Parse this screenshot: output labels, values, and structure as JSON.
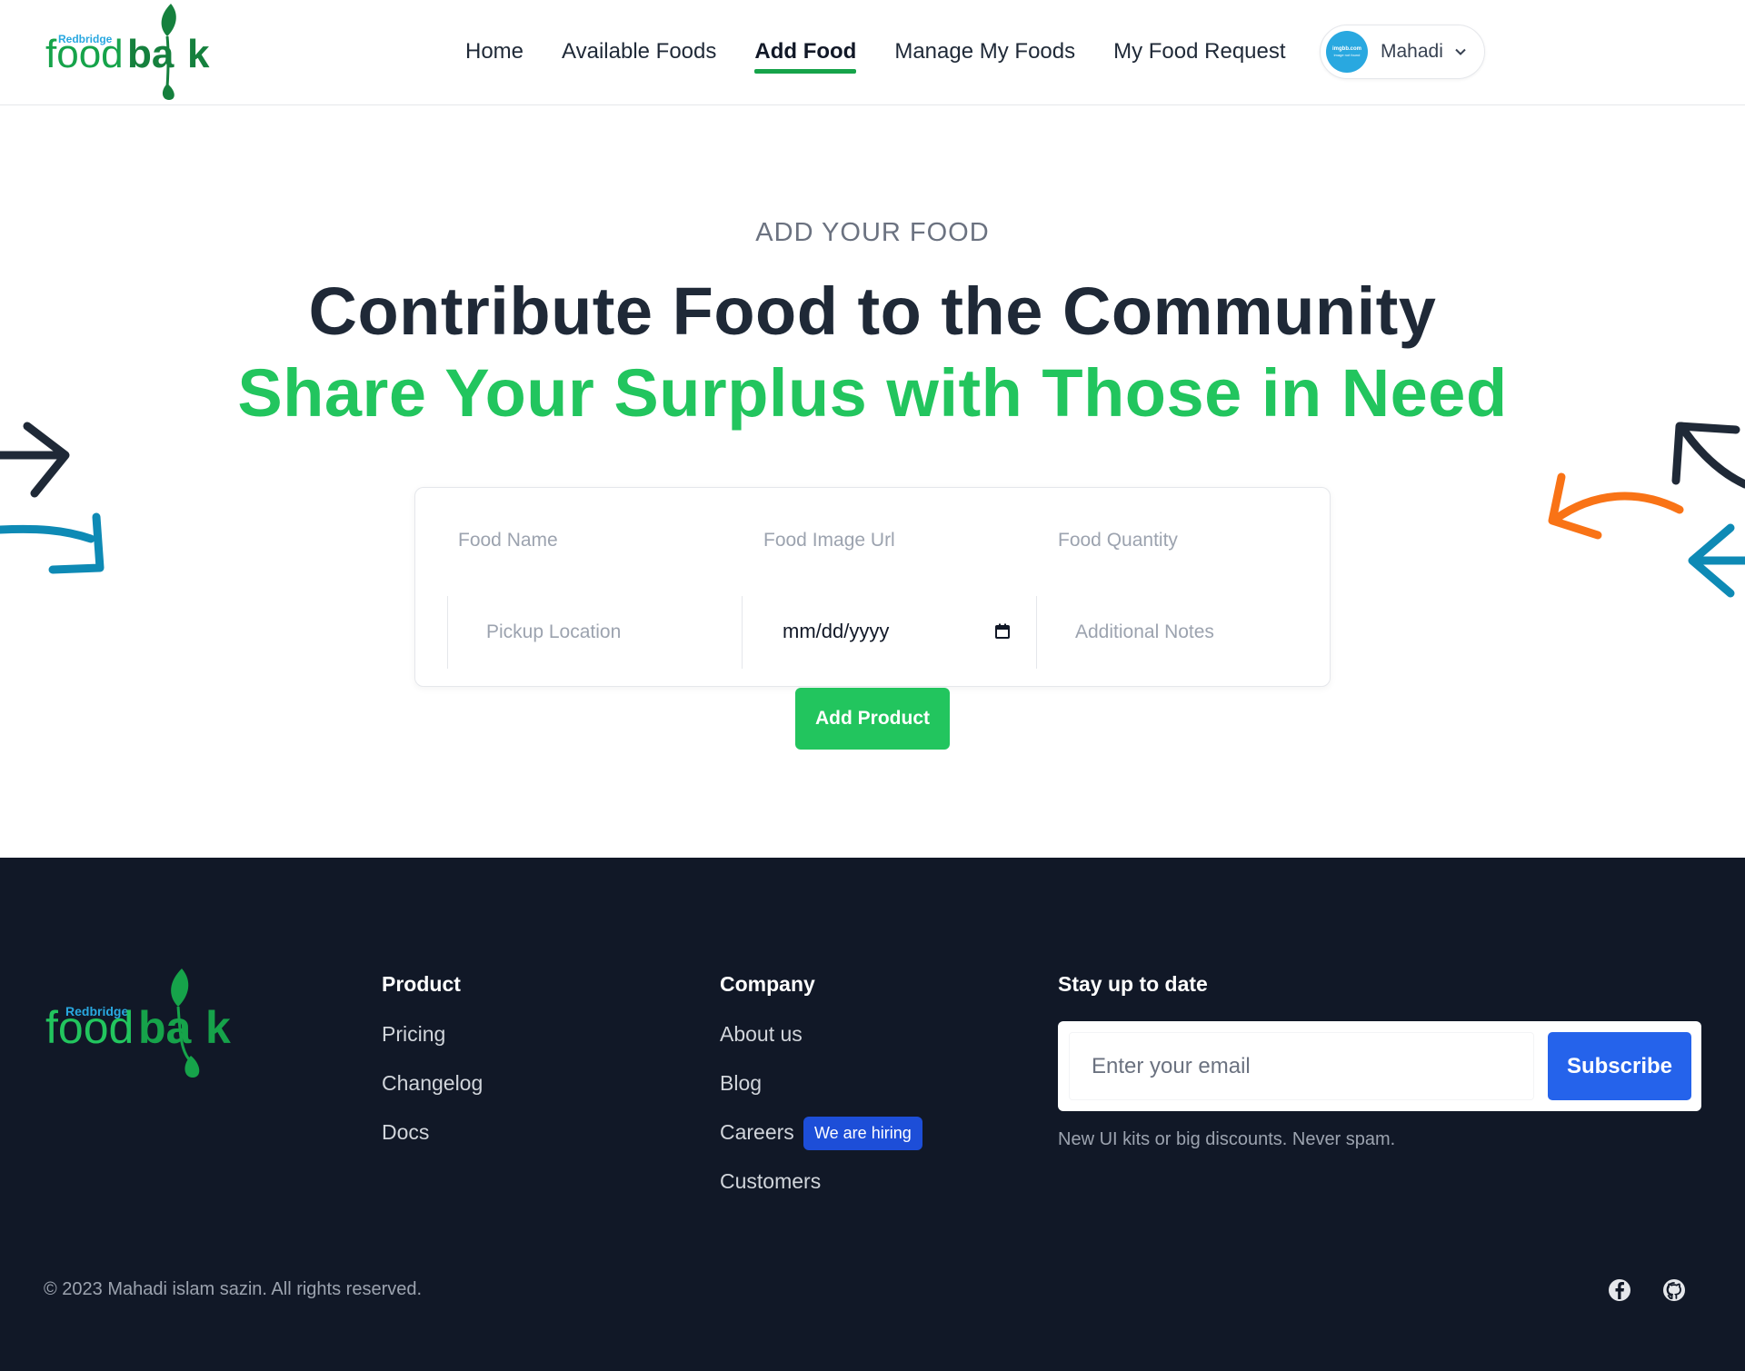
{
  "brand": {
    "small": "Redbridge",
    "word_a": "food",
    "word_b": "ba",
    "word_c": "k"
  },
  "nav": {
    "links": [
      "Home",
      "Available Foods",
      "Add Food",
      "Manage My Foods",
      "My Food Request"
    ],
    "active": "Add Food",
    "user": {
      "name": "Mahadi",
      "avatar_line1": "imgbb.com",
      "avatar_line2": "image not found"
    }
  },
  "hero": {
    "eyebrow": "ADD YOUR FOOD",
    "title": "Contribute Food to the Community",
    "subtitle": "Share Your Surplus with Those in Need"
  },
  "form": {
    "food_name_placeholder": "Food Name",
    "food_image_placeholder": "Food Image Url",
    "food_quantity_placeholder": "Food Quantity",
    "pickup_location_placeholder": "Pickup Location",
    "date_placeholder": "mm/dd/yyyy",
    "notes_placeholder": "Additional Notes",
    "submit_label": "Add Product"
  },
  "footer": {
    "product": {
      "title": "Product",
      "links": [
        "Pricing",
        "Changelog",
        "Docs"
      ]
    },
    "company": {
      "title": "Company",
      "links": [
        "About us",
        "Blog",
        "Careers",
        "Customers"
      ],
      "badge": "We are hiring"
    },
    "newsletter": {
      "title": "Stay up to date",
      "email_placeholder": "Enter your email",
      "button": "Subscribe",
      "note": "New UI kits or big discounts. Never spam."
    },
    "copyright": "© 2023 Mahadi islam sazin. All rights reserved.",
    "social": [
      "facebook-icon",
      "github-icon"
    ]
  },
  "colors": {
    "accent_green": "#22c55e",
    "footer_bg": "#111827",
    "subscribe_blue": "#2563eb",
    "hiring_badge": "#1d4ed8"
  }
}
